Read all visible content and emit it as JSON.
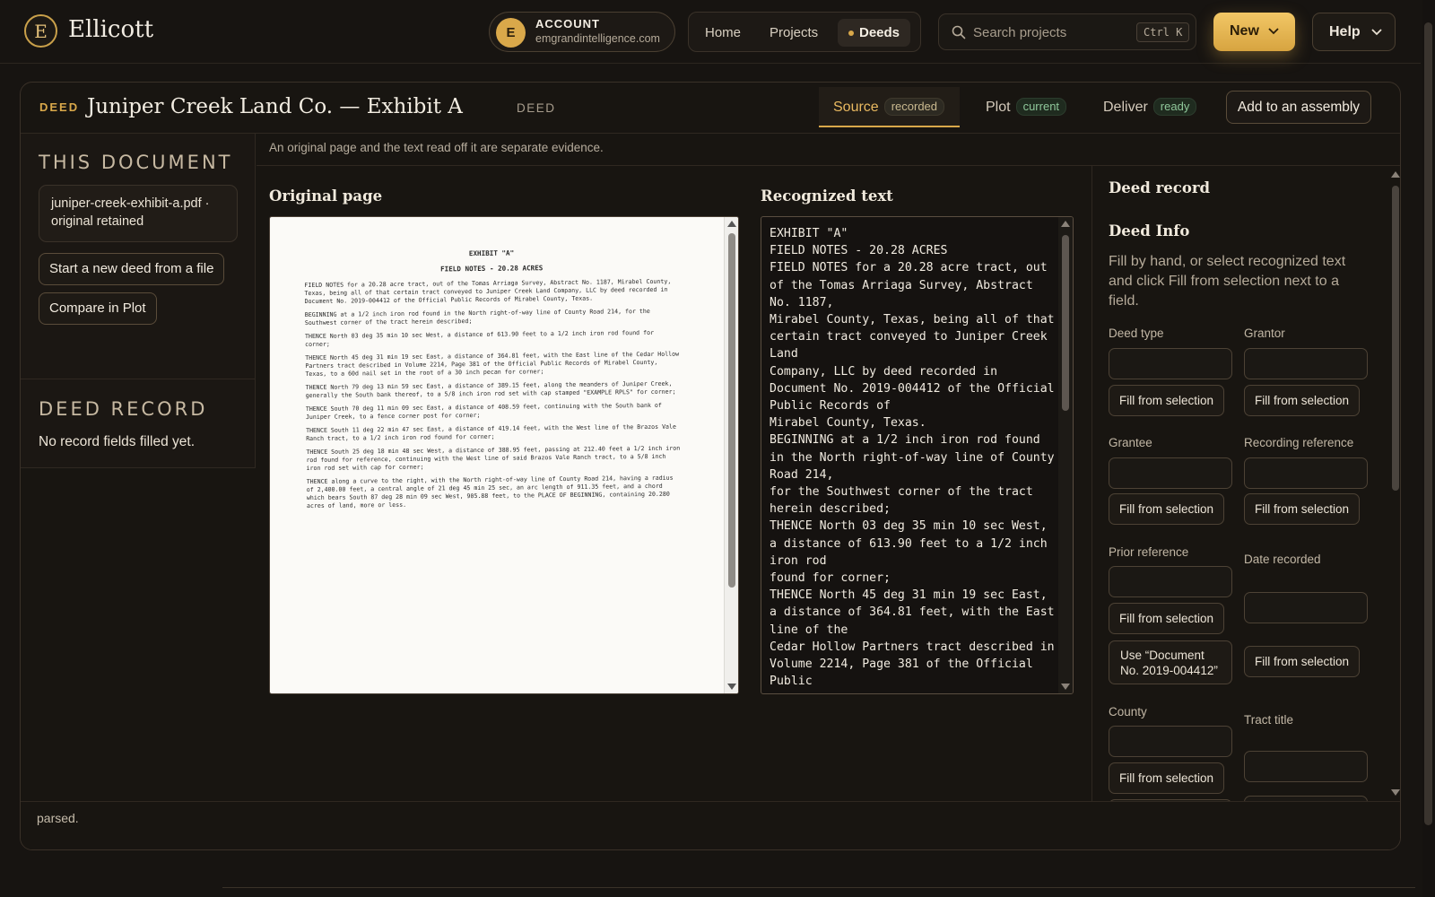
{
  "app": {
    "logo_letter": "E",
    "name": "Ellicott"
  },
  "account": {
    "avatar": "E",
    "label": "ACCOUNT",
    "email": "emgrandintelligence.com"
  },
  "nav": {
    "home": "Home",
    "projects": "Projects",
    "deeds": "Deeds"
  },
  "search": {
    "placeholder": "Search projects",
    "shortcut": "Ctrl K"
  },
  "header_buttons": {
    "new": "New",
    "help": "Help"
  },
  "document": {
    "kind": "DEED",
    "title": "Juniper Creek Land Co. — Exhibit A",
    "type": "DEED",
    "tabs": [
      {
        "label": "Source",
        "badge": "recorded"
      },
      {
        "label": "Plot",
        "badge": "current"
      },
      {
        "label": "Deliver",
        "badge": "ready"
      }
    ],
    "add_to_assembly": "Add to an assembly"
  },
  "sidebar": {
    "this_document_heading": "THIS DOCUMENT",
    "file_name": "juniper-creek-exhibit-a.pdf ·",
    "file_status": "original retained",
    "start_new_button": "Start a new deed from a file",
    "compare_button": "Compare in Plot",
    "deed_record_heading": "DEED RECORD",
    "deed_record_note": "No record fields filled yet."
  },
  "content": {
    "note": "An original page and the text read off it are separate evidence.",
    "original_heading": "Original page",
    "recognized_heading": "Recognized text"
  },
  "scan": {
    "title": "EXHIBIT \"A\"",
    "subtitle": "FIELD NOTES - 20.28 ACRES",
    "paragraphs": [
      "FIELD NOTES for a 20.28 acre tract, out of the Tomas Arriaga Survey, Abstract No. 1187, Mirabel County, Texas, being all of that certain tract conveyed to Juniper Creek Land Company, LLC by deed recorded in Document No. 2019-004412 of the Official Public Records of Mirabel County, Texas.",
      "BEGINNING at a 1/2 inch iron rod found in the North right-of-way line of County Road 214, for the Southwest corner of the tract herein described;",
      "THENCE North 03 deg 35 min 10 sec West, a distance of 613.90 feet to a 1/2 inch iron rod found for corner;",
      "THENCE North 45 deg 31 min 19 sec East, a distance of 364.81 feet, with the East line of the Cedar Hollow Partners tract described in Volume 2214, Page 381 of the Official Public Records of Mirabel County, Texas, to a 60d nail set in the root of a 30 inch pecan for corner;",
      "THENCE North 79 deg 13 min 59 sec East, a distance of 389.15 feet, along the meanders of Juniper Creek, generally the South bank thereof, to a 5/8 inch iron rod set with cap stamped \"EXAMPLE RPLS\" for corner;",
      "THENCE South 70 deg 11 min 09 sec East, a distance of 408.59 feet, continuing with the South bank of Juniper Creek, to a fence corner post for corner;",
      "THENCE South 11 deg 22 min 47 sec East, a distance of 419.14 feet, with the West line of the Brazos Vale Ranch tract, to a 1/2 inch iron rod found for corner;",
      "THENCE South 25 deg 18 min 48 sec West, a distance of 388.95 feet, passing at 212.40 feet a 1/2 inch iron rod found for reference, continuing with the West line of said Brazos Vale Ranch tract, to a 5/8 inch iron rod set with cap for corner;",
      "THENCE along a curve to the right, with the North right-of-way line of County Road 214, having a radius of 2,400.00 feet, a central angle of 21 deg 45 min 25 sec, an arc length of 911.35 feet, and a chord which bears South 87 deg 28 min 09 sec West, 905.88 feet, to the PLACE OF BEGINNING, containing 20.280 acres of land, more or less."
    ]
  },
  "recognized_text": "EXHIBIT \"A\"\nFIELD NOTES - 20.28 ACRES\nFIELD NOTES for a 20.28 acre tract, out of the Tomas Arriaga Survey, Abstract No. 1187,\nMirabel County, Texas, being all of that certain tract conveyed to Juniper Creek Land\nCompany, LLC by deed recorded in Document No. 2019-004412 of the Official Public Records of\nMirabel County, Texas.\nBEGINNING at a 1/2 inch iron rod found in the North right-of-way line of County Road 214,\nfor the Southwest corner of the tract herein described;\nTHENCE North 03 deg 35 min 10 sec West, a distance of 613.90 feet to a 1/2 inch iron rod\nfound for corner;\nTHENCE North 45 deg 31 min 19 sec East, a distance of 364.81 feet, with the East line of the\nCedar Hollow Partners tract described in Volume 2214, Page 381 of the Official Public",
  "record": {
    "title": "Deed record",
    "section": "Deed Info",
    "hint": "Fill by hand, or select recognized text and click Fill from selection next to a field.",
    "fill_label": "Fill from selection",
    "fields": {
      "deed_type": "Deed type",
      "grantor": "Grantor",
      "grantee": "Grantee",
      "recording_reference": "Recording reference",
      "prior_reference": "Prior reference",
      "date_recorded": "Date recorded",
      "county": "County",
      "tract_title": "Tract title"
    },
    "use_suggestion": "Use “Document No. 2019-004412”"
  },
  "status": "parsed.",
  "colors": {
    "accent": "#d9a84a",
    "background": "#171411",
    "ok_badge": "#8fc79a"
  }
}
